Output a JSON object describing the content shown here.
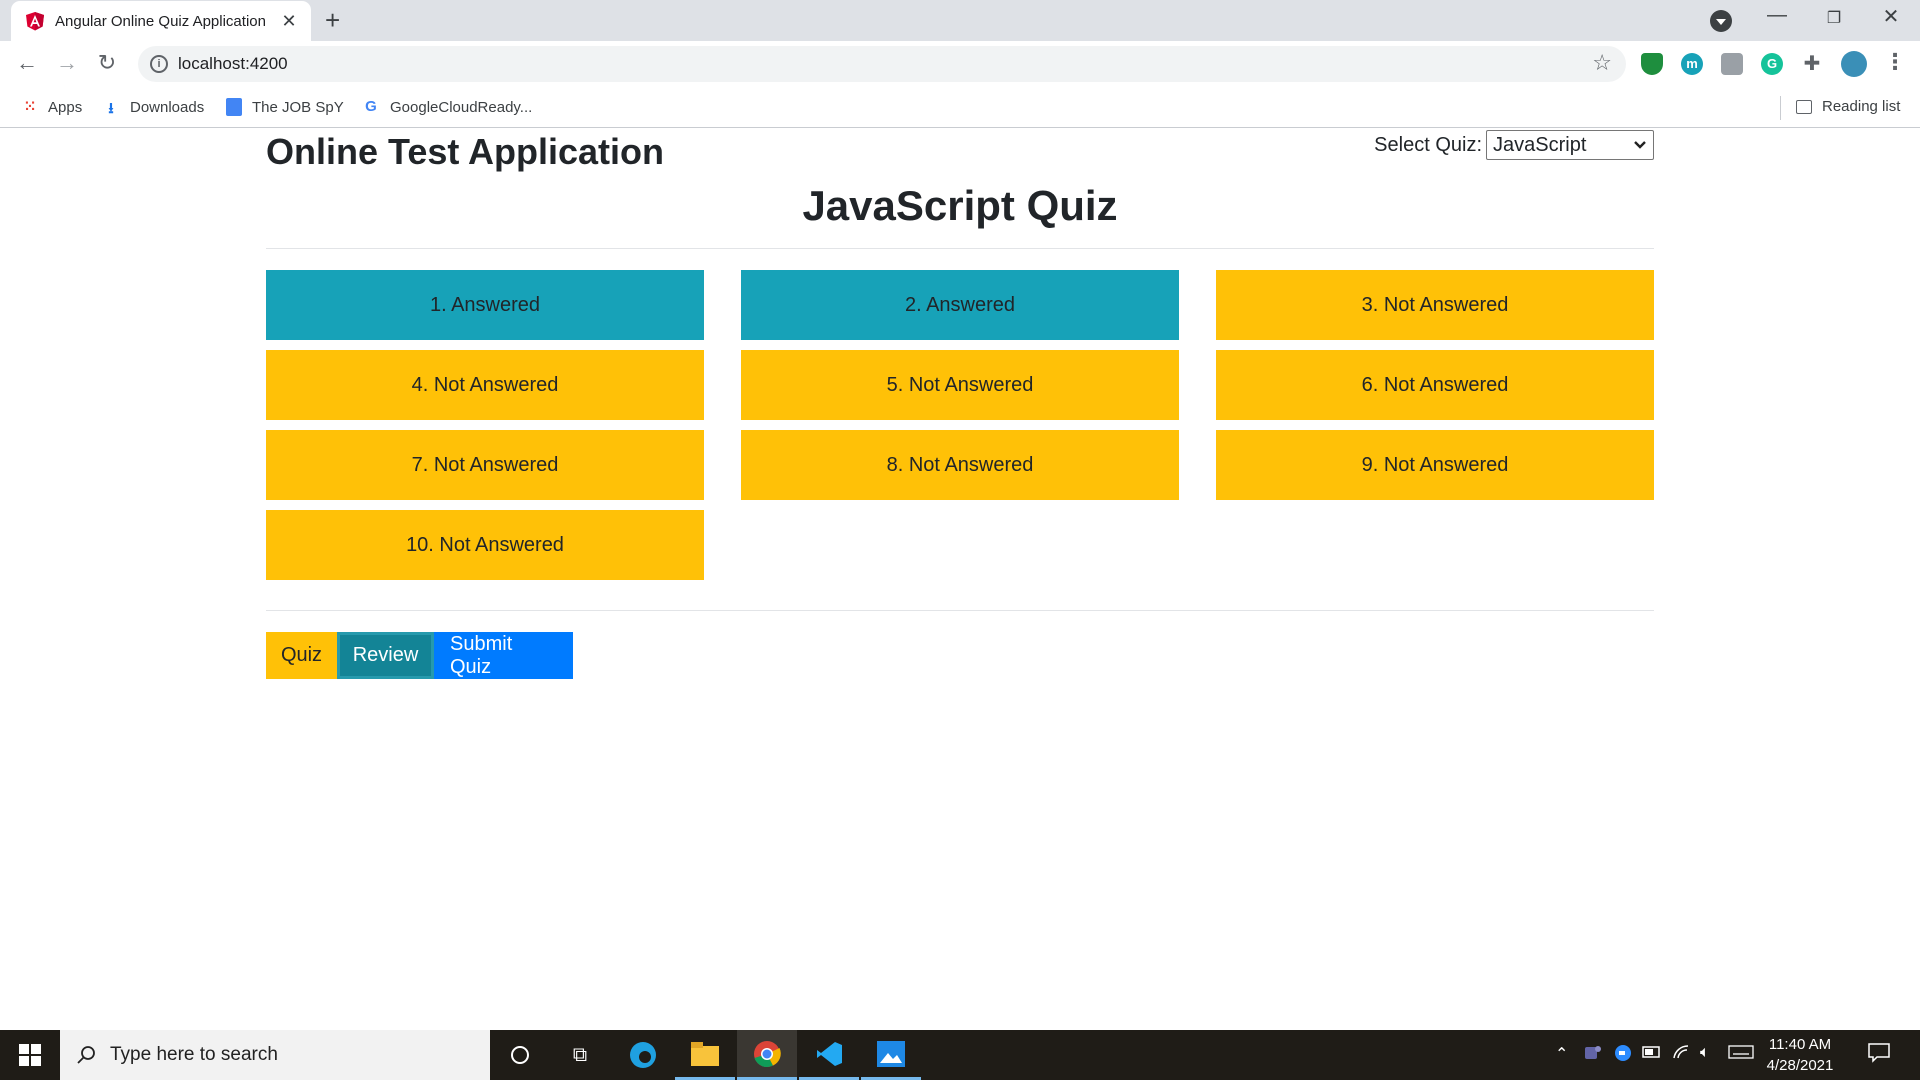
{
  "browser": {
    "tab_title": "Angular Online Quiz Application",
    "url": "localhost:4200",
    "bookmarks": [
      "Apps",
      "Downloads",
      "The JOB SpY",
      "GoogleCloudReady..."
    ],
    "reading_list": "Reading list"
  },
  "app": {
    "title": "Online Test Application",
    "select_label": "Select Quiz:",
    "selected_quiz": "JavaScript",
    "quiz_title": "JavaScript Quiz",
    "questions": [
      {
        "label": "1. Answered",
        "status": "answered"
      },
      {
        "label": "2. Answered",
        "status": "answered"
      },
      {
        "label": "3. Not Answered",
        "status": "not-answered"
      },
      {
        "label": "4. Not Answered",
        "status": "not-answered"
      },
      {
        "label": "5. Not Answered",
        "status": "not-answered"
      },
      {
        "label": "6. Not Answered",
        "status": "not-answered"
      },
      {
        "label": "7. Not Answered",
        "status": "not-answered"
      },
      {
        "label": "8. Not Answered",
        "status": "not-answered"
      },
      {
        "label": "9. Not Answered",
        "status": "not-answered"
      },
      {
        "label": "10. Not Answered",
        "status": "not-answered"
      }
    ],
    "buttons": {
      "quiz": "Quiz",
      "review": "Review",
      "submit": "Submit Quiz"
    },
    "colors": {
      "answered": "#17a2b8",
      "not_answered": "#ffc107",
      "primary": "#007bff"
    }
  },
  "taskbar": {
    "search_placeholder": "Type here to search",
    "time": "11:40 AM",
    "date": "4/28/2021"
  }
}
